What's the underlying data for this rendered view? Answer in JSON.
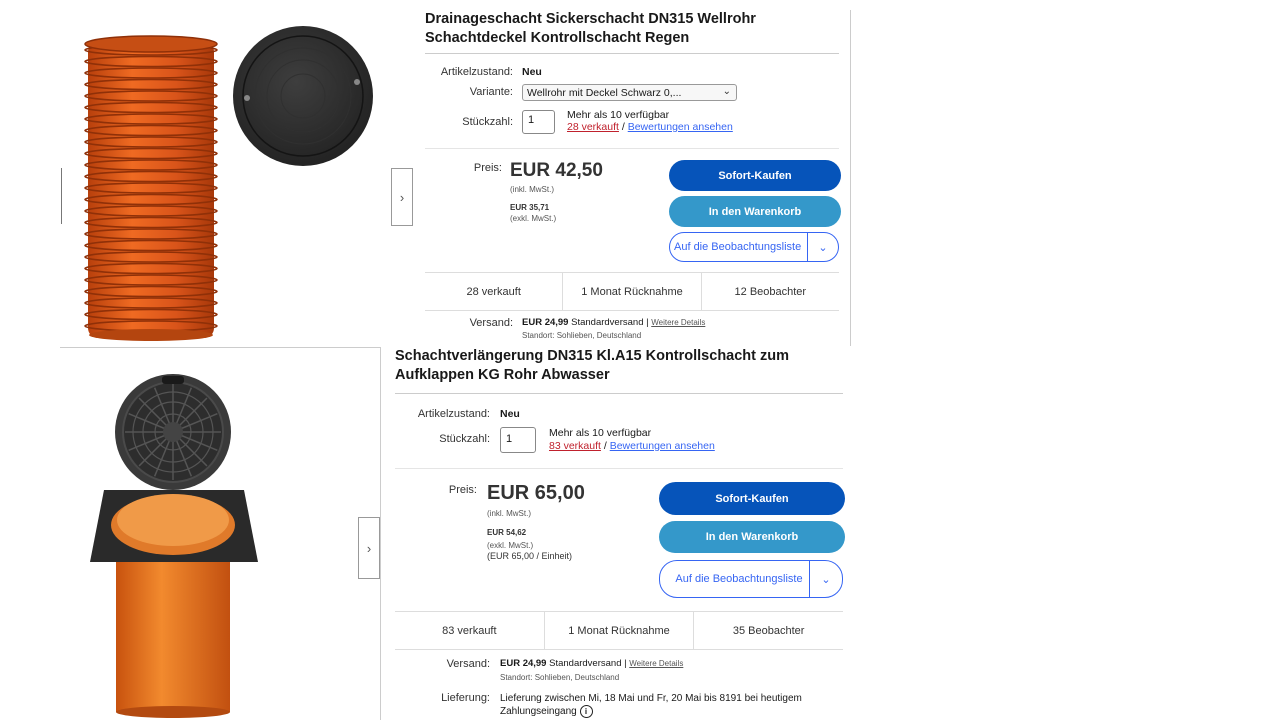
{
  "listing1": {
    "title": "Drainageschacht Sickerschacht DN315 Wellrohr Schachtdeckel Kontrollschacht Regen",
    "condition_label": "Artikelzustand:",
    "condition_value": "Neu",
    "variant_label": "Variante:",
    "variant_value": "Wellrohr mit Deckel Schwarz 0,...",
    "qty_label": "Stückzahl:",
    "qty_value": "1",
    "availability": "Mehr als 10 verfügbar",
    "sold_link": "28 verkauft",
    "separator": "/",
    "reviews_link": "Bewertungen ansehen",
    "price_label": "Preis:",
    "price": "EUR 42,50",
    "price_note": "(inkl. MwSt.)",
    "net_price": "EUR 35,71",
    "net_note": "(exkl. MwSt.)",
    "buy_now": "Sofort-Kaufen",
    "add_cart": "In den Warenkorb",
    "watchlist": "Auf die Beobachtungsliste",
    "stats": [
      "28 verkauft",
      "1 Monat Rücknahme",
      "12 Beobachter"
    ],
    "shipping_label": "Versand:",
    "shipping_price": "EUR 24,99",
    "shipping_text": "Standardversand |",
    "shipping_details": "Weitere Details",
    "location": "Standort: Sohlieben, Deutschland"
  },
  "listing2": {
    "title": "Schachtverlängerung DN315 Kl.A15 Kontrollschacht zum Aufklappen KG Rohr Abwasser",
    "condition_label": "Artikelzustand:",
    "condition_value": "Neu",
    "qty_label": "Stückzahl:",
    "qty_value": "1",
    "availability": "Mehr als 10 verfügbar",
    "sold_link": "83 verkauft",
    "separator": "/",
    "reviews_link": "Bewertungen ansehen",
    "price_label": "Preis:",
    "price": "EUR 65,00",
    "price_note": "(inkl. MwSt.)",
    "net_price": "EUR 54,62",
    "net_note": "(exkl. MwSt.)",
    "unit_note": "(EUR 65,00 / Einheit)",
    "buy_now": "Sofort-Kaufen",
    "add_cart": "In den Warenkorb",
    "watchlist": "Auf die Beobachtungsliste",
    "stats": [
      "83 verkauft",
      "1 Monat Rücknahme",
      "35 Beobachter"
    ],
    "shipping_label": "Versand:",
    "shipping_price": "EUR 24,99",
    "shipping_text": "Standardversand |",
    "shipping_details": "Weitere Details",
    "location": "Standort: Sohlieben, Deutschland",
    "delivery_label": "Lieferung:",
    "delivery_text": "Lieferung zwischen Mi, 18 Mai und Fr, 20 Mai bis 8191 bei heutigem Zahlungseingang"
  },
  "colors": {
    "buy_now": "#0654ba",
    "add_cart": "#3498ca",
    "sold_red": "#c0212d",
    "link": "#3665f3",
    "pipe_orange": "#e0601c"
  }
}
